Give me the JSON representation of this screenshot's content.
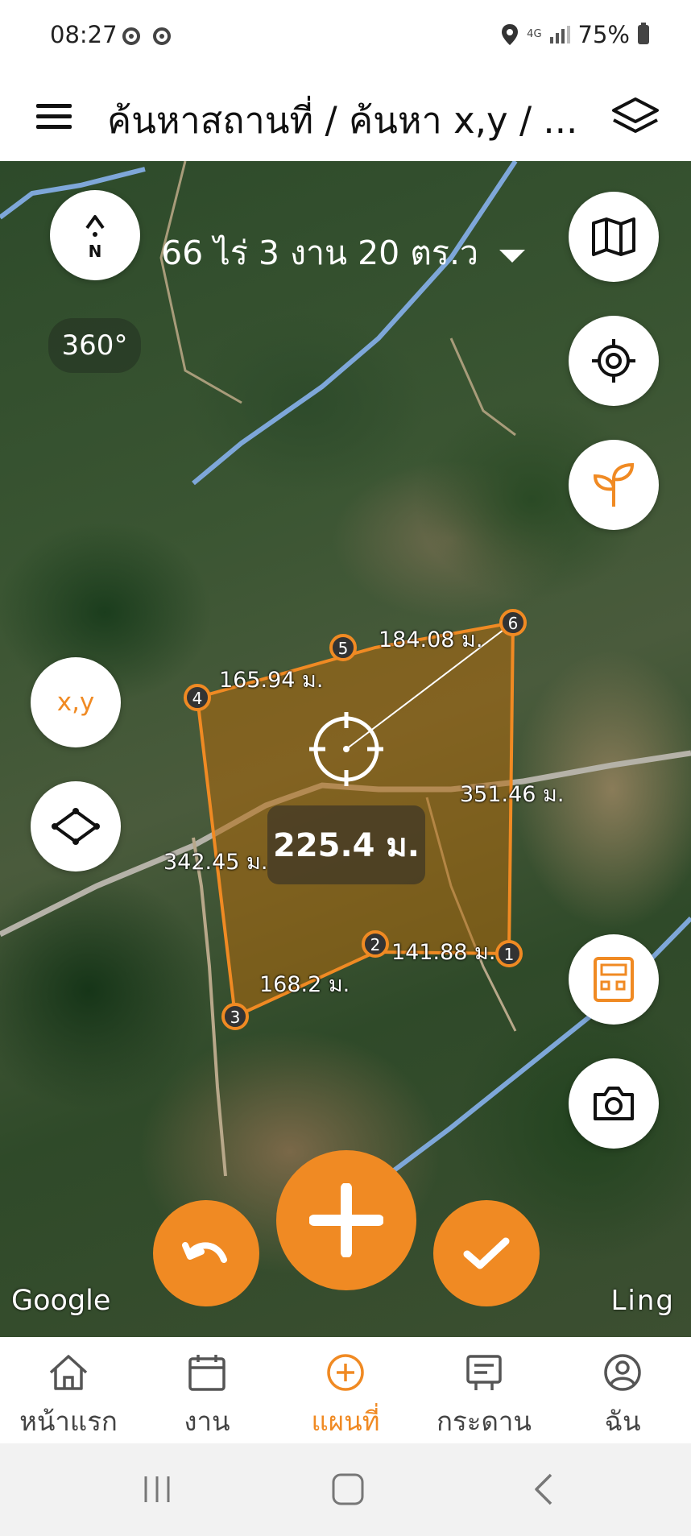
{
  "status_bar": {
    "time": "08:27",
    "network": "4G",
    "battery": "75%"
  },
  "header": {
    "title": "ค้นหาสถานที่ / ค้นหา x,y / ..."
  },
  "map": {
    "area": "66 ไร่ 3 งาน 20 ตร.ว",
    "compass_label": "N",
    "rotation_label": "360°",
    "xy_button": "x,y",
    "distance": "225.4 ม.",
    "points": [
      "1",
      "2",
      "3",
      "4",
      "5",
      "6"
    ],
    "edges": [
      "141.88 ม.",
      "168.2 ม.",
      "342.45 ม.",
      "165.94 ม.",
      "184.08 ม.",
      "351.46 ม."
    ],
    "map_attribution": "Google",
    "watermark": "Ling",
    "accent_color": "#f08a23"
  },
  "nav": {
    "items": [
      {
        "label": "หน้าแรก",
        "icon": "home-icon"
      },
      {
        "label": "งาน",
        "icon": "calendar-icon"
      },
      {
        "label": "แผนที่",
        "icon": "plus-circle-icon"
      },
      {
        "label": "กระดาน",
        "icon": "board-icon"
      },
      {
        "label": "ฉัน",
        "icon": "user-icon"
      }
    ]
  }
}
